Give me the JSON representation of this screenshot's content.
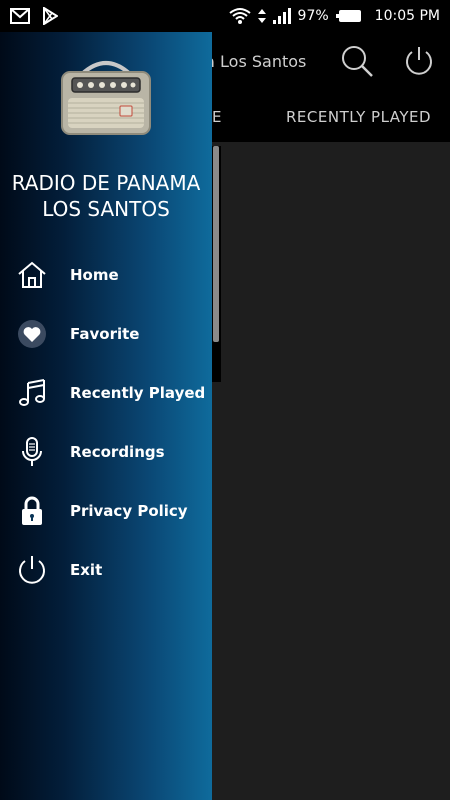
{
  "status_bar": {
    "battery": "97%",
    "time": "10:05 PM",
    "icons": [
      "gmail-icon",
      "play-store-icon",
      "wifi-icon",
      "data-arrows-icon",
      "signal-icon",
      "battery-icon"
    ]
  },
  "app_bar": {
    "title_visible": "na Los Santos",
    "icons": [
      "search-icon",
      "power-icon"
    ]
  },
  "tabs": [
    {
      "label": "E"
    },
    {
      "label": "RECENTLY PLAYED"
    }
  ],
  "drawer": {
    "title": "RADIO DE PANAMA LOS SANTOS",
    "logo": "vintage-radio-image",
    "items": [
      {
        "label": "Home",
        "icon": "home-icon"
      },
      {
        "label": "Favorite",
        "icon": "heart-icon"
      },
      {
        "label": "Recently Played",
        "icon": "music-note-icon"
      },
      {
        "label": "Recordings",
        "icon": "microphone-icon"
      },
      {
        "label": "Privacy Policy",
        "icon": "lock-icon"
      },
      {
        "label": "Exit",
        "icon": "power-icon"
      }
    ]
  },
  "colors": {
    "drawer_start": "#000a18",
    "drawer_end": "#0f6b9c",
    "app_bar": "#000000",
    "content_bg": "#1e1e1e"
  }
}
